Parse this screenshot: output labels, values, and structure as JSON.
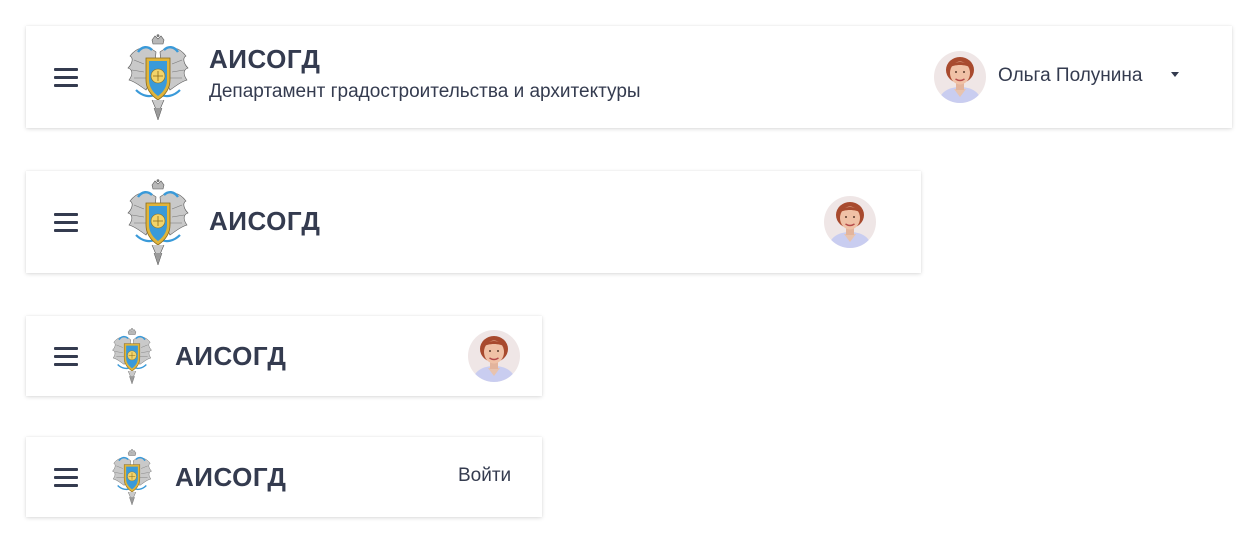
{
  "headers": [
    {
      "title": "АИСОГД",
      "subtitle": "Департамент градостроительства и архитектуры",
      "user": {
        "name": "Ольга Полунина"
      }
    },
    {
      "title": "АИСОГД"
    },
    {
      "title": "АИСОГД"
    },
    {
      "title": "АИСОГД",
      "login_label": "Войти"
    }
  ],
  "colors": {
    "text": "#343b4f",
    "background": "#ffffff",
    "emblem_blue": "#3a9ad9",
    "emblem_gold": "#e0b43a"
  }
}
